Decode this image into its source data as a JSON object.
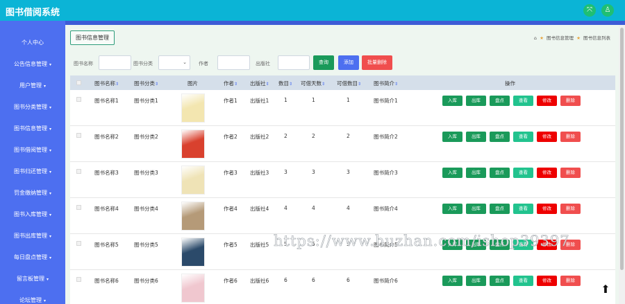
{
  "app": {
    "title": "图书借阅系统"
  },
  "topbar": {
    "fullscreen_icon": "expand-icon",
    "user_icon": "user-icon"
  },
  "sidebar": {
    "items": [
      {
        "label": "个人中心"
      },
      {
        "label": "公告信息管理"
      },
      {
        "label": "用户管理"
      },
      {
        "label": "图书分类管理"
      },
      {
        "label": "图书信息管理"
      },
      {
        "label": "图书借阅管理"
      },
      {
        "label": "图书归还管理"
      },
      {
        "label": "罚金缴纳管理"
      },
      {
        "label": "图书入库管理"
      },
      {
        "label": "图书出库管理"
      },
      {
        "label": "每日盘点管理"
      },
      {
        "label": "留言板管理"
      },
      {
        "label": "论坛管理"
      }
    ]
  },
  "page": {
    "title": "图书信息管理",
    "breadcrumb": [
      "图书信息管理",
      "图书信息列表"
    ]
  },
  "search": {
    "name_label": "图书名称",
    "category_label": "图书分类",
    "author_label": "作者",
    "publisher_label": "出版社",
    "search_button": "查询",
    "add_button": "添加",
    "batch_delete_button": "批量删除"
  },
  "table": {
    "columns": [
      "图书名称",
      "图书分类",
      "图片",
      "作者",
      "出版社",
      "数目",
      "可借天数",
      "可借数目",
      "图书简介",
      "操作"
    ],
    "actions": [
      "入库",
      "出库",
      "盘点",
      "查看",
      "修改",
      "删除"
    ],
    "rows": [
      {
        "name": "图书名称1",
        "category": "图书分类1",
        "author": "作者1",
        "publisher": "出版社1",
        "count": "1",
        "days": "1",
        "available": "1",
        "intro": "图书简介1",
        "cover": "#f3e6b0"
      },
      {
        "name": "图书名称2",
        "category": "图书分类2",
        "author": "作者2",
        "publisher": "出版社2",
        "count": "2",
        "days": "2",
        "available": "2",
        "intro": "图书简介2",
        "cover": "#d9412e"
      },
      {
        "name": "图书名称3",
        "category": "图书分类3",
        "author": "作者3",
        "publisher": "出版社3",
        "count": "3",
        "days": "3",
        "available": "3",
        "intro": "图书简介3",
        "cover": "#efe3b6"
      },
      {
        "name": "图书名称4",
        "category": "图书分类4",
        "author": "作者4",
        "publisher": "出版社4",
        "count": "4",
        "days": "4",
        "available": "4",
        "intro": "图书简介4",
        "cover": "#b59a78"
      },
      {
        "name": "图书名称5",
        "category": "图书分类5",
        "author": "作者5",
        "publisher": "出版社5",
        "count": "5",
        "days": "5",
        "available": "5",
        "intro": "图书简介5",
        "cover": "#2b4a6a"
      },
      {
        "name": "图书名称6",
        "category": "图书分类6",
        "author": "作者6",
        "publisher": "出版社6",
        "count": "6",
        "days": "6",
        "available": "6",
        "intro": "图书简介6",
        "cover": "#f0c7cf"
      }
    ]
  },
  "watermark": "https://www.huzhan.com/ishop39397",
  "colors": {
    "topbar": "#0bb4d6",
    "sidebar": "#4d6ff0",
    "search": "#1a9a5a",
    "add": "#4d6ff0",
    "danger": "#f04e4e",
    "stock": "#1a9a5a",
    "view": "#22c38e",
    "edit": "#ee0000"
  }
}
